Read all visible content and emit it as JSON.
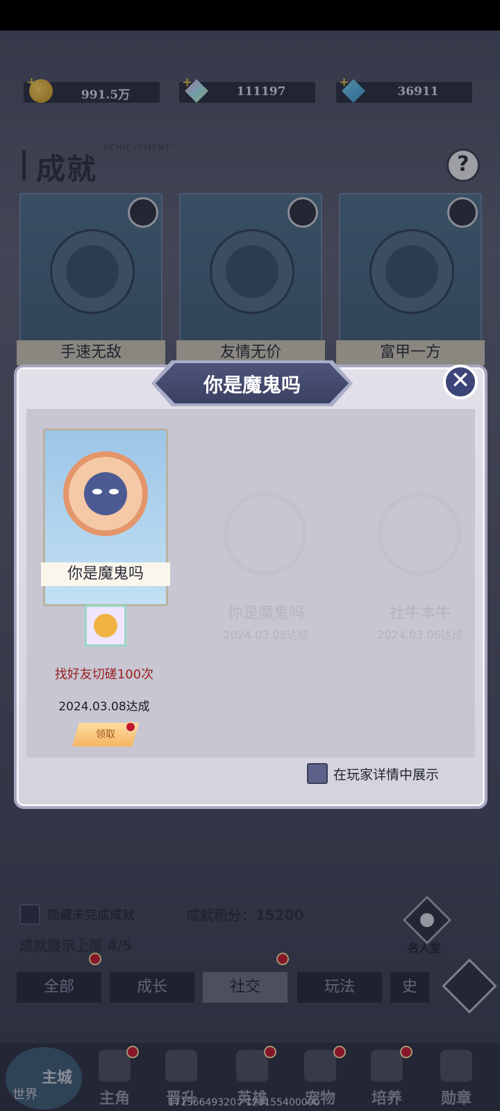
{
  "currencies": [
    {
      "icon": "gold-coin-icon",
      "value": "991.5万"
    },
    {
      "icon": "rainbow-gem-icon",
      "value": "111197"
    },
    {
      "icon": "blue-crystal-icon",
      "value": "36911"
    }
  ],
  "page": {
    "title": "成就",
    "subtitle_en": "ACHIEVEMENT",
    "help": "?"
  },
  "achievements": [
    {
      "label": "手速无敌"
    },
    {
      "label": "友情无价"
    },
    {
      "label": "富甲一方"
    }
  ],
  "modal": {
    "title": "你是魔鬼吗",
    "close": "✕",
    "medal_name": "你是魔鬼吗",
    "condition": "找好友切磋100次",
    "date": "2024.03.08达成",
    "claim": "领取",
    "show_label": "在玩家详情中展示",
    "ghost": [
      {
        "name": "你是魔鬼吗",
        "date": "2024.03.08达成"
      },
      {
        "name": "社牛本牛",
        "date": "2024.03.06达成"
      }
    ]
  },
  "filters": {
    "hide_label": "隐藏未完成成就",
    "score": "成就积分：15200",
    "limit": "成就展示上限 4/5",
    "hall": "名人堂"
  },
  "tabs": [
    "全部",
    "成长",
    "社交",
    "玩法",
    "史"
  ],
  "bottom_nav": {
    "main_city": "主城",
    "world": "世界",
    "items": [
      "主角",
      "晋升",
      "英雄",
      "宠物",
      "培养",
      "勋章"
    ]
  },
  "debug_text": "17156649320 / 123155400000",
  "colors": {
    "accent": "#3c4577",
    "condition": "#9c1f1f",
    "reddot": "#c2172c"
  }
}
